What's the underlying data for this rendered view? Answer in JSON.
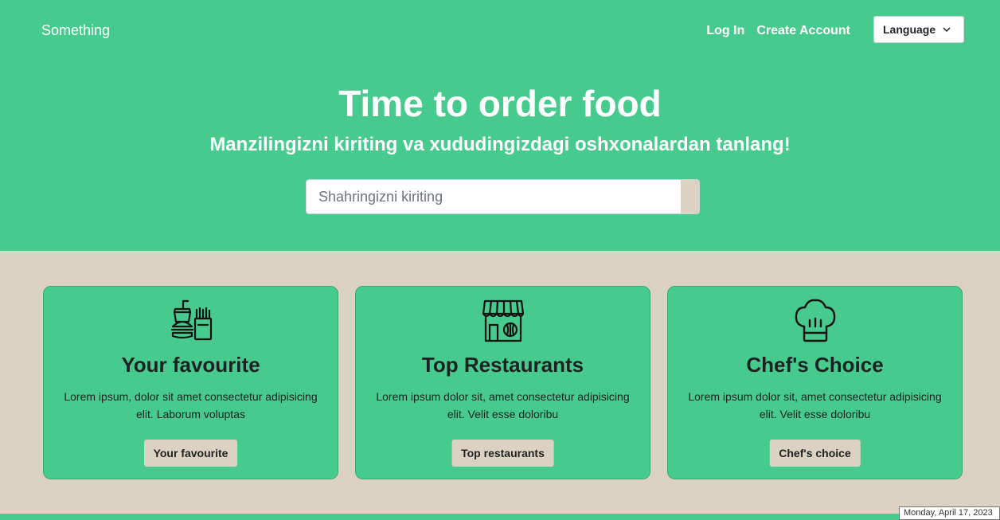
{
  "header": {
    "brand": "Something",
    "nav": {
      "login": "Log In",
      "create_account": "Create Account"
    },
    "language_label": "Language"
  },
  "hero": {
    "title": "Time to order food",
    "subtitle": "Manzilingizni kiriting va xududingizdagi oshxonalardan tanlang!",
    "search_placeholder": "Shahringizni kiriting"
  },
  "cards": [
    {
      "icon": "fast-food-icon",
      "title": "Your favourite",
      "text": "Lorem ipsum, dolor sit amet consectetur adipisicing elit. Laborum voluptas",
      "button": "Your favourite"
    },
    {
      "icon": "store-icon",
      "title": "Top Restaurants",
      "text": "Lorem ipsum dolor sit, amet consectetur adipisicing elit. Velit esse doloribu",
      "button": "Top restaurants"
    },
    {
      "icon": "chef-hat-icon",
      "title": "Chef's Choice",
      "text": "Lorem ipsum dolor sit, amet consectetur adipisicing elit. Velit esse doloribu",
      "button": "Chef's choice"
    }
  ],
  "tooltip": {
    "date": "Monday, April 17, 2023"
  },
  "colors": {
    "primary": "#47ca8d",
    "secondary": "#dcd2c2",
    "text_dark": "#1d2124"
  }
}
